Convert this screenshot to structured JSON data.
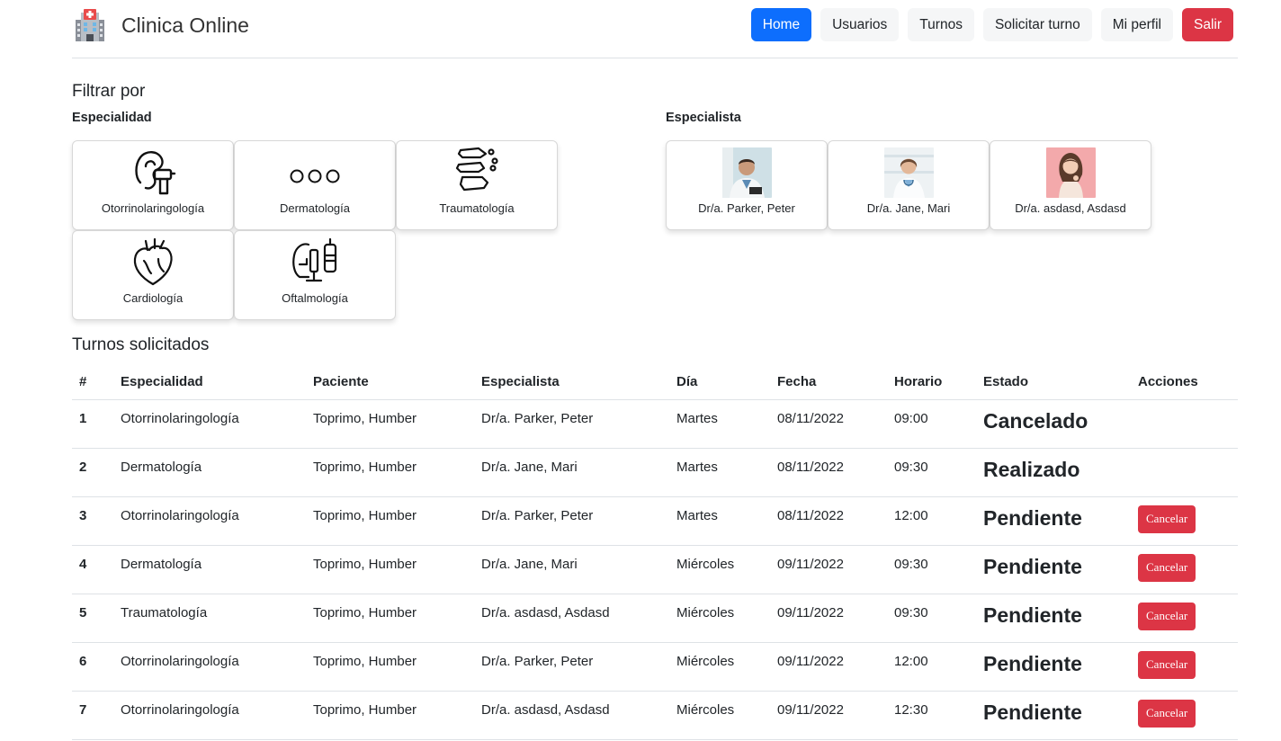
{
  "brand": {
    "title": "Clinica Online",
    "logo_icon": "hospital-icon"
  },
  "nav": {
    "home": "Home",
    "usuarios": "Usuarios",
    "turnos": "Turnos",
    "solicitar": "Solicitar turno",
    "perfil": "Mi perfil",
    "salir": "Salir"
  },
  "filter": {
    "title": "Filtrar por",
    "especialidad_label": "Especialidad",
    "especialista_label": "Especialista",
    "especialidades": [
      {
        "label": "Otorrinolaringología",
        "icon": "ear-icon"
      },
      {
        "label": "Dermatología",
        "icon": "skin-cells-icon"
      },
      {
        "label": "Traumatología",
        "icon": "bones-icon"
      },
      {
        "label": "Cardiología",
        "icon": "heart-icon"
      },
      {
        "label": "Oftalmología",
        "icon": "eye-exam-icon"
      }
    ],
    "especialistas": [
      {
        "label": "Dr/a. Parker, Peter"
      },
      {
        "label": "Dr/a. Jane, Mari"
      },
      {
        "label": "Dr/a. asdasd, Asdasd"
      }
    ]
  },
  "table": {
    "title": "Turnos solicitados",
    "headers": [
      "#",
      "Especialidad",
      "Paciente",
      "Especialista",
      "Día",
      "Fecha",
      "Horario",
      "Estado",
      "Acciones"
    ],
    "cancel_label": "Cancelar",
    "rows": [
      {
        "n": "1",
        "esp": "Otorrinolaringología",
        "pac": "Toprimo, Humber",
        "doc": "Dr/a. Parker, Peter",
        "dia": "Martes",
        "fecha": "08/11/2022",
        "hora": "09:00",
        "estado": "Cancelado"
      },
      {
        "n": "2",
        "esp": "Dermatología",
        "pac": "Toprimo, Humber",
        "doc": "Dr/a. Jane, Mari",
        "dia": "Martes",
        "fecha": "08/11/2022",
        "hora": "09:30",
        "estado": "Realizado"
      },
      {
        "n": "3",
        "esp": "Otorrinolaringología",
        "pac": "Toprimo, Humber",
        "doc": "Dr/a. Parker, Peter",
        "dia": "Martes",
        "fecha": "08/11/2022",
        "hora": "12:00",
        "estado": "Pendiente"
      },
      {
        "n": "4",
        "esp": "Dermatología",
        "pac": "Toprimo, Humber",
        "doc": "Dr/a. Jane, Mari",
        "dia": "Miércoles",
        "fecha": "09/11/2022",
        "hora": "09:30",
        "estado": "Pendiente"
      },
      {
        "n": "5",
        "esp": "Traumatología",
        "pac": "Toprimo, Humber",
        "doc": "Dr/a. asdasd, Asdasd",
        "dia": "Miércoles",
        "fecha": "09/11/2022",
        "hora": "09:30",
        "estado": "Pendiente"
      },
      {
        "n": "6",
        "esp": "Otorrinolaringología",
        "pac": "Toprimo, Humber",
        "doc": "Dr/a. Parker, Peter",
        "dia": "Miércoles",
        "fecha": "09/11/2022",
        "hora": "12:00",
        "estado": "Pendiente"
      },
      {
        "n": "7",
        "esp": "Otorrinolaringología",
        "pac": "Toprimo, Humber",
        "doc": "Dr/a. asdasd, Asdasd",
        "dia": "Miércoles",
        "fecha": "09/11/2022",
        "hora": "12:30",
        "estado": "Pendiente"
      }
    ]
  }
}
